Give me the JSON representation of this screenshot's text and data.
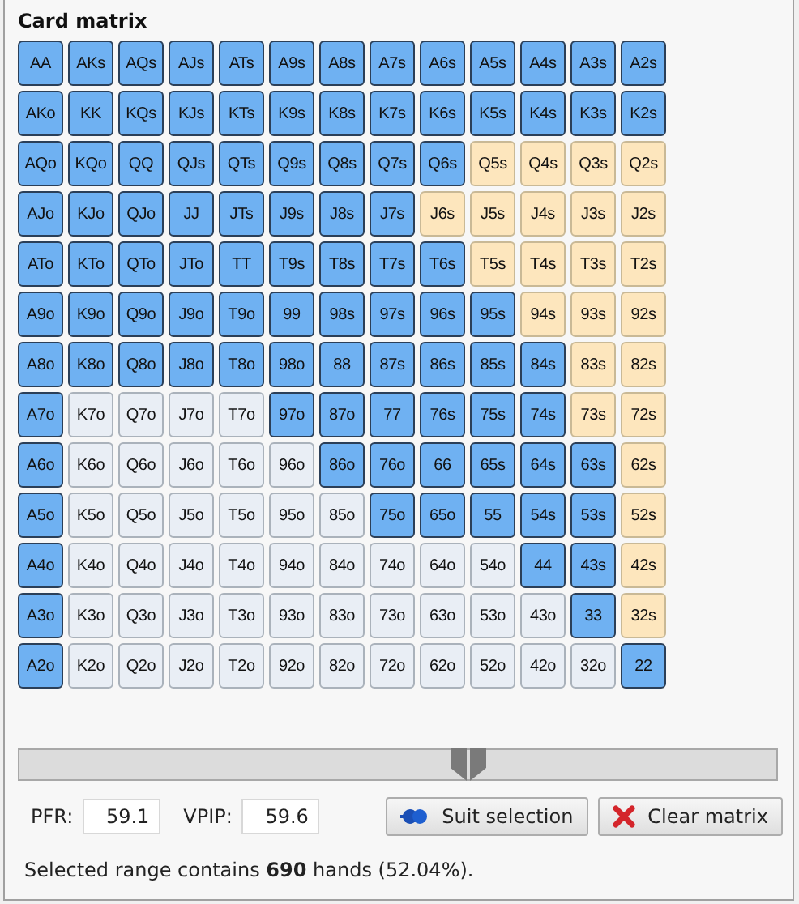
{
  "title": "Card matrix",
  "matrix": [
    [
      {
        "label": "AA",
        "kind": "raise"
      },
      {
        "label": "AKs",
        "kind": "raise"
      },
      {
        "label": "AQs",
        "kind": "raise"
      },
      {
        "label": "AJs",
        "kind": "raise"
      },
      {
        "label": "ATs",
        "kind": "raise"
      },
      {
        "label": "A9s",
        "kind": "raise"
      },
      {
        "label": "A8s",
        "kind": "raise"
      },
      {
        "label": "A7s",
        "kind": "raise"
      },
      {
        "label": "A6s",
        "kind": "raise"
      },
      {
        "label": "A5s",
        "kind": "raise"
      },
      {
        "label": "A4s",
        "kind": "raise"
      },
      {
        "label": "A3s",
        "kind": "raise"
      },
      {
        "label": "A2s",
        "kind": "raise"
      }
    ],
    [
      {
        "label": "AKo",
        "kind": "raise"
      },
      {
        "label": "KK",
        "kind": "raise"
      },
      {
        "label": "KQs",
        "kind": "raise"
      },
      {
        "label": "KJs",
        "kind": "raise"
      },
      {
        "label": "KTs",
        "kind": "raise"
      },
      {
        "label": "K9s",
        "kind": "raise"
      },
      {
        "label": "K8s",
        "kind": "raise"
      },
      {
        "label": "K7s",
        "kind": "raise"
      },
      {
        "label": "K6s",
        "kind": "raise"
      },
      {
        "label": "K5s",
        "kind": "raise"
      },
      {
        "label": "K4s",
        "kind": "raise"
      },
      {
        "label": "K3s",
        "kind": "raise"
      },
      {
        "label": "K2s",
        "kind": "raise"
      }
    ],
    [
      {
        "label": "AQo",
        "kind": "raise"
      },
      {
        "label": "KQo",
        "kind": "raise"
      },
      {
        "label": "QQ",
        "kind": "raise"
      },
      {
        "label": "QJs",
        "kind": "raise"
      },
      {
        "label": "QTs",
        "kind": "raise"
      },
      {
        "label": "Q9s",
        "kind": "raise"
      },
      {
        "label": "Q8s",
        "kind": "raise"
      },
      {
        "label": "Q7s",
        "kind": "raise"
      },
      {
        "label": "Q6s",
        "kind": "raise"
      },
      {
        "label": "Q5s",
        "kind": "call"
      },
      {
        "label": "Q4s",
        "kind": "call"
      },
      {
        "label": "Q3s",
        "kind": "call"
      },
      {
        "label": "Q2s",
        "kind": "call"
      }
    ],
    [
      {
        "label": "AJo",
        "kind": "raise"
      },
      {
        "label": "KJo",
        "kind": "raise"
      },
      {
        "label": "QJo",
        "kind": "raise"
      },
      {
        "label": "JJ",
        "kind": "raise"
      },
      {
        "label": "JTs",
        "kind": "raise"
      },
      {
        "label": "J9s",
        "kind": "raise"
      },
      {
        "label": "J8s",
        "kind": "raise"
      },
      {
        "label": "J7s",
        "kind": "raise"
      },
      {
        "label": "J6s",
        "kind": "call"
      },
      {
        "label": "J5s",
        "kind": "call"
      },
      {
        "label": "J4s",
        "kind": "call"
      },
      {
        "label": "J3s",
        "kind": "call"
      },
      {
        "label": "J2s",
        "kind": "call"
      }
    ],
    [
      {
        "label": "ATo",
        "kind": "raise"
      },
      {
        "label": "KTo",
        "kind": "raise"
      },
      {
        "label": "QTo",
        "kind": "raise"
      },
      {
        "label": "JTo",
        "kind": "raise"
      },
      {
        "label": "TT",
        "kind": "raise"
      },
      {
        "label": "T9s",
        "kind": "raise"
      },
      {
        "label": "T8s",
        "kind": "raise"
      },
      {
        "label": "T7s",
        "kind": "raise"
      },
      {
        "label": "T6s",
        "kind": "raise"
      },
      {
        "label": "T5s",
        "kind": "call"
      },
      {
        "label": "T4s",
        "kind": "call"
      },
      {
        "label": "T3s",
        "kind": "call"
      },
      {
        "label": "T2s",
        "kind": "call"
      }
    ],
    [
      {
        "label": "A9o",
        "kind": "raise"
      },
      {
        "label": "K9o",
        "kind": "raise"
      },
      {
        "label": "Q9o",
        "kind": "raise"
      },
      {
        "label": "J9o",
        "kind": "raise"
      },
      {
        "label": "T9o",
        "kind": "raise"
      },
      {
        "label": "99",
        "kind": "raise"
      },
      {
        "label": "98s",
        "kind": "raise"
      },
      {
        "label": "97s",
        "kind": "raise"
      },
      {
        "label": "96s",
        "kind": "raise"
      },
      {
        "label": "95s",
        "kind": "raise"
      },
      {
        "label": "94s",
        "kind": "call"
      },
      {
        "label": "93s",
        "kind": "call"
      },
      {
        "label": "92s",
        "kind": "call"
      }
    ],
    [
      {
        "label": "A8o",
        "kind": "raise"
      },
      {
        "label": "K8o",
        "kind": "raise"
      },
      {
        "label": "Q8o",
        "kind": "raise"
      },
      {
        "label": "J8o",
        "kind": "raise"
      },
      {
        "label": "T8o",
        "kind": "raise"
      },
      {
        "label": "98o",
        "kind": "raise"
      },
      {
        "label": "88",
        "kind": "raise"
      },
      {
        "label": "87s",
        "kind": "raise"
      },
      {
        "label": "86s",
        "kind": "raise"
      },
      {
        "label": "85s",
        "kind": "raise"
      },
      {
        "label": "84s",
        "kind": "raise"
      },
      {
        "label": "83s",
        "kind": "call"
      },
      {
        "label": "82s",
        "kind": "call"
      }
    ],
    [
      {
        "label": "A7o",
        "kind": "raise"
      },
      {
        "label": "K7o",
        "kind": "none"
      },
      {
        "label": "Q7o",
        "kind": "none"
      },
      {
        "label": "J7o",
        "kind": "none"
      },
      {
        "label": "T7o",
        "kind": "none"
      },
      {
        "label": "97o",
        "kind": "raise"
      },
      {
        "label": "87o",
        "kind": "raise"
      },
      {
        "label": "77",
        "kind": "raise"
      },
      {
        "label": "76s",
        "kind": "raise"
      },
      {
        "label": "75s",
        "kind": "raise"
      },
      {
        "label": "74s",
        "kind": "raise"
      },
      {
        "label": "73s",
        "kind": "call"
      },
      {
        "label": "72s",
        "kind": "call"
      }
    ],
    [
      {
        "label": "A6o",
        "kind": "raise"
      },
      {
        "label": "K6o",
        "kind": "none"
      },
      {
        "label": "Q6o",
        "kind": "none"
      },
      {
        "label": "J6o",
        "kind": "none"
      },
      {
        "label": "T6o",
        "kind": "none"
      },
      {
        "label": "96o",
        "kind": "none"
      },
      {
        "label": "86o",
        "kind": "raise"
      },
      {
        "label": "76o",
        "kind": "raise"
      },
      {
        "label": "66",
        "kind": "raise"
      },
      {
        "label": "65s",
        "kind": "raise"
      },
      {
        "label": "64s",
        "kind": "raise"
      },
      {
        "label": "63s",
        "kind": "raise"
      },
      {
        "label": "62s",
        "kind": "call"
      }
    ],
    [
      {
        "label": "A5o",
        "kind": "raise"
      },
      {
        "label": "K5o",
        "kind": "none"
      },
      {
        "label": "Q5o",
        "kind": "none"
      },
      {
        "label": "J5o",
        "kind": "none"
      },
      {
        "label": "T5o",
        "kind": "none"
      },
      {
        "label": "95o",
        "kind": "none"
      },
      {
        "label": "85o",
        "kind": "none"
      },
      {
        "label": "75o",
        "kind": "raise"
      },
      {
        "label": "65o",
        "kind": "raise"
      },
      {
        "label": "55",
        "kind": "raise"
      },
      {
        "label": "54s",
        "kind": "raise"
      },
      {
        "label": "53s",
        "kind": "raise"
      },
      {
        "label": "52s",
        "kind": "call"
      }
    ],
    [
      {
        "label": "A4o",
        "kind": "raise"
      },
      {
        "label": "K4o",
        "kind": "none"
      },
      {
        "label": "Q4o",
        "kind": "none"
      },
      {
        "label": "J4o",
        "kind": "none"
      },
      {
        "label": "T4o",
        "kind": "none"
      },
      {
        "label": "94o",
        "kind": "none"
      },
      {
        "label": "84o",
        "kind": "none"
      },
      {
        "label": "74o",
        "kind": "none"
      },
      {
        "label": "64o",
        "kind": "none"
      },
      {
        "label": "54o",
        "kind": "none"
      },
      {
        "label": "44",
        "kind": "raise"
      },
      {
        "label": "43s",
        "kind": "raise"
      },
      {
        "label": "42s",
        "kind": "call"
      }
    ],
    [
      {
        "label": "A3o",
        "kind": "raise"
      },
      {
        "label": "K3o",
        "kind": "none"
      },
      {
        "label": "Q3o",
        "kind": "none"
      },
      {
        "label": "J3o",
        "kind": "none"
      },
      {
        "label": "T3o",
        "kind": "none"
      },
      {
        "label": "93o",
        "kind": "none"
      },
      {
        "label": "83o",
        "kind": "none"
      },
      {
        "label": "73o",
        "kind": "none"
      },
      {
        "label": "63o",
        "kind": "none"
      },
      {
        "label": "53o",
        "kind": "none"
      },
      {
        "label": "43o",
        "kind": "none"
      },
      {
        "label": "33",
        "kind": "raise"
      },
      {
        "label": "32s",
        "kind": "call"
      }
    ],
    [
      {
        "label": "A2o",
        "kind": "raise"
      },
      {
        "label": "K2o",
        "kind": "none"
      },
      {
        "label": "Q2o",
        "kind": "none"
      },
      {
        "label": "J2o",
        "kind": "none"
      },
      {
        "label": "T2o",
        "kind": "none"
      },
      {
        "label": "92o",
        "kind": "none"
      },
      {
        "label": "82o",
        "kind": "none"
      },
      {
        "label": "72o",
        "kind": "none"
      },
      {
        "label": "62o",
        "kind": "none"
      },
      {
        "label": "52o",
        "kind": "none"
      },
      {
        "label": "42o",
        "kind": "none"
      },
      {
        "label": "32o",
        "kind": "none"
      },
      {
        "label": "22",
        "kind": "raise"
      }
    ]
  ],
  "slider": {
    "handles": [
      {
        "level": 0.591
      },
      {
        "level": 0.596
      }
    ]
  },
  "fields": [
    {
      "label": "PFR:",
      "value": "59.1"
    },
    {
      "label": "VPIP:",
      "value": "59.6"
    }
  ],
  "buttons": [
    {
      "label": "Suit selection",
      "kind": "suits"
    },
    {
      "label": "Clear matrix",
      "kind": "clear"
    }
  ],
  "status": "Selected range contains **690** hands (52.04%)."
}
